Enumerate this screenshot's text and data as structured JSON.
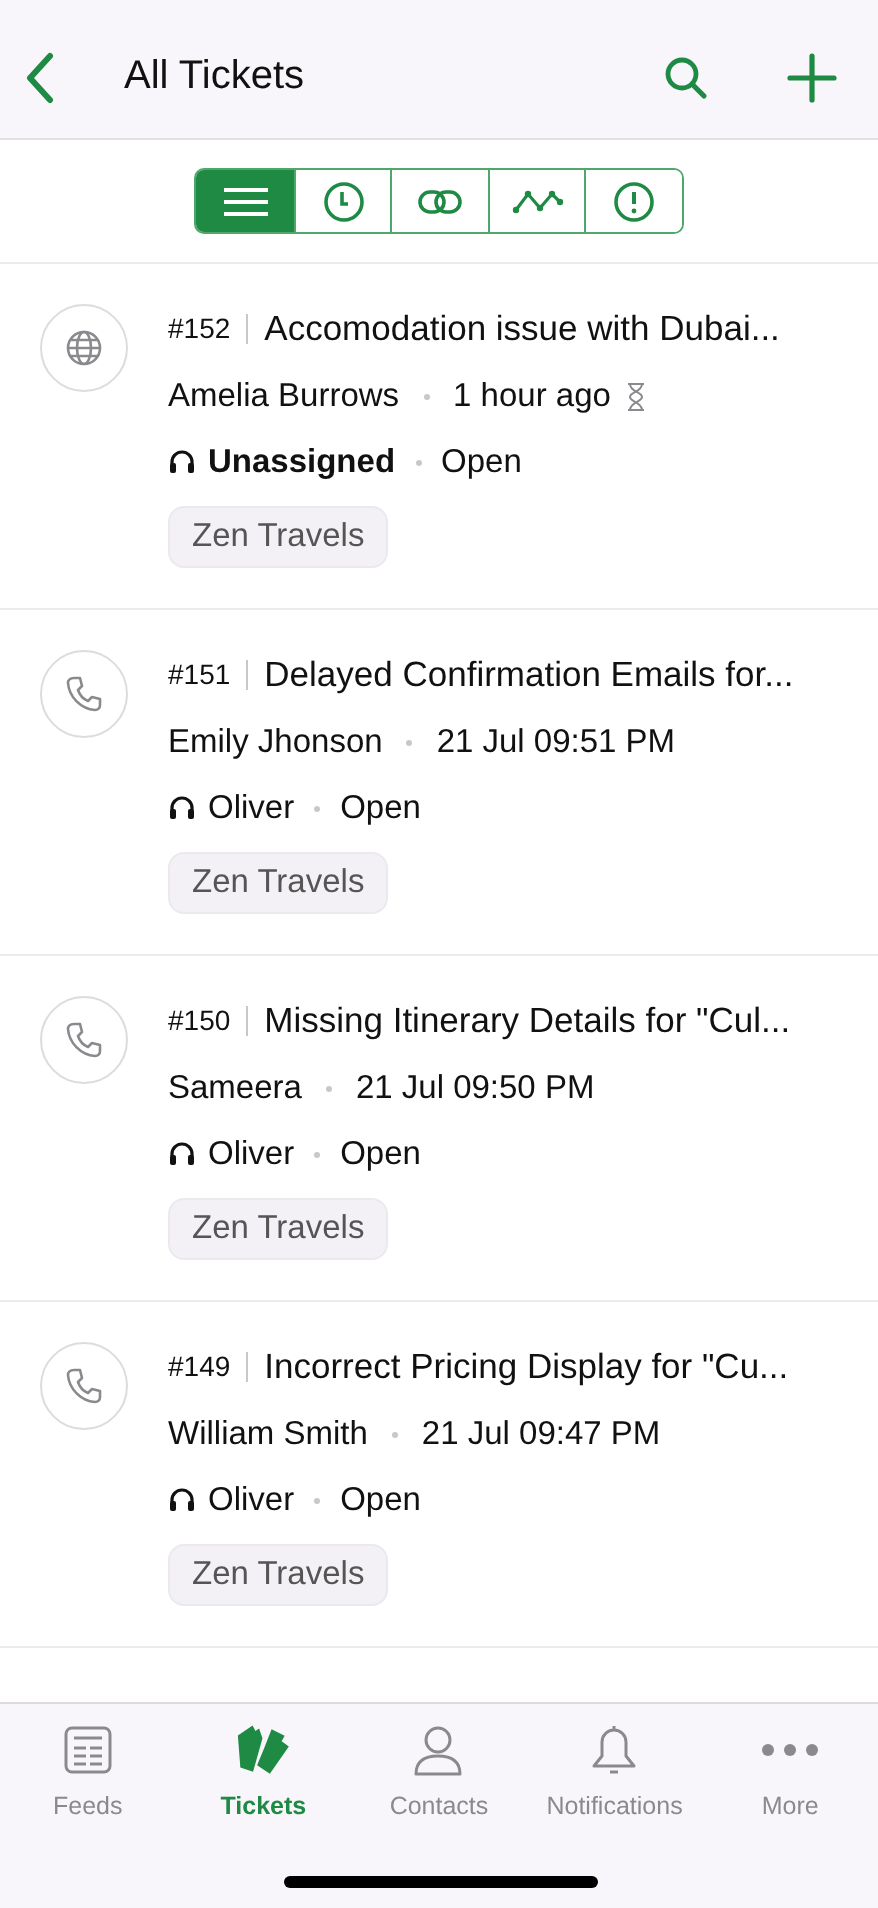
{
  "header": {
    "title": "All Tickets"
  },
  "view_switcher": [
    {
      "kind": "list",
      "selected": true
    },
    {
      "kind": "clock",
      "selected": false
    },
    {
      "kind": "link",
      "selected": false
    },
    {
      "kind": "trend",
      "selected": false
    },
    {
      "kind": "alert",
      "selected": false
    }
  ],
  "tickets": [
    {
      "kind": "web",
      "number": "#152",
      "subject": "Accomodation issue with Dubai...",
      "contact": "Amelia Burrows",
      "time": "1 hour ago",
      "timer": true,
      "assignee": "Unassigned",
      "assigned": false,
      "status": "Open",
      "tag": "Zen Travels"
    },
    {
      "kind": "phone",
      "number": "#151",
      "subject": "Delayed Confirmation Emails for...",
      "contact": "Emily Jhonson",
      "time": "21 Jul 09:51 PM",
      "timer": false,
      "assignee": "Oliver",
      "assigned": true,
      "status": "Open",
      "tag": "Zen Travels"
    },
    {
      "kind": "phone",
      "number": "#150",
      "subject": "Missing Itinerary Details for \"Cul...",
      "contact": "Sameera",
      "time": "21 Jul 09:50 PM",
      "timer": false,
      "assignee": "Oliver",
      "assigned": true,
      "status": "Open",
      "tag": "Zen Travels"
    },
    {
      "kind": "phone",
      "number": "#149",
      "subject": "Incorrect Pricing Display for \"Cu...",
      "contact": "William Smith",
      "time": "21 Jul 09:47 PM",
      "timer": false,
      "assignee": "Oliver",
      "assigned": true,
      "status": "Open",
      "tag": "Zen Travels"
    }
  ],
  "tab_bar": [
    {
      "kind": "feeds",
      "label": "Feeds",
      "selected": false
    },
    {
      "kind": "tickets",
      "label": "Tickets",
      "selected": true
    },
    {
      "kind": "contacts",
      "label": "Contacts",
      "selected": false
    },
    {
      "kind": "notifications",
      "label": "Notifications",
      "selected": false
    },
    {
      "kind": "more",
      "label": "More",
      "selected": false
    }
  ]
}
